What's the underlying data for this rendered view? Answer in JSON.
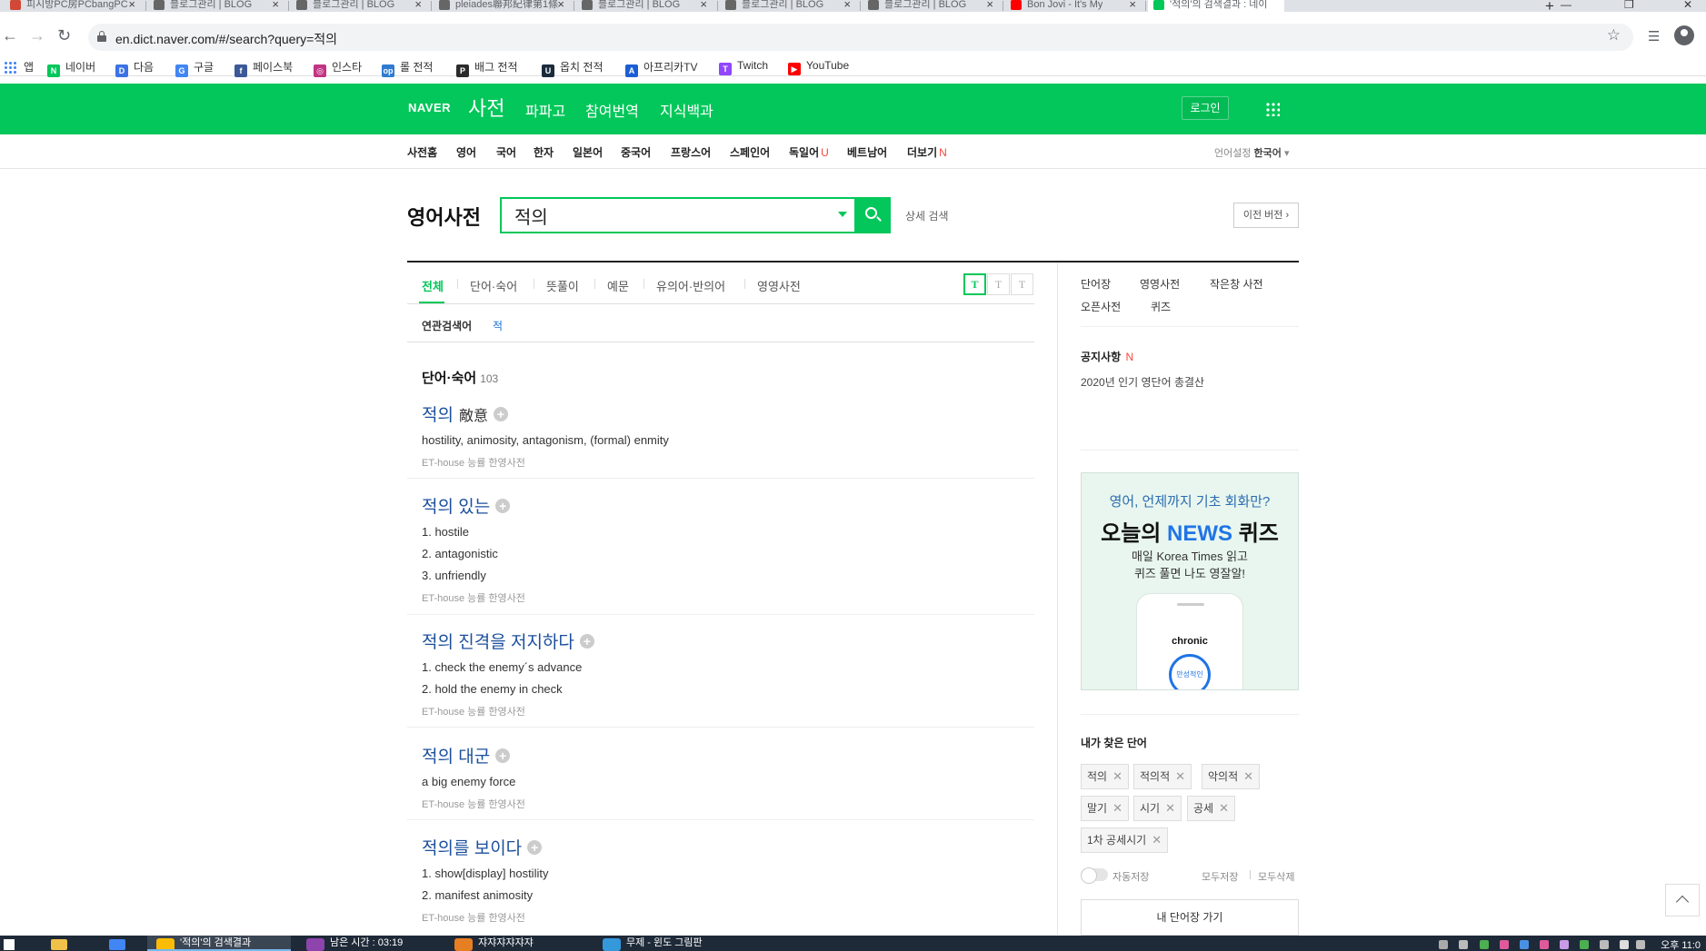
{
  "browser": {
    "tabs": [
      {
        "label": "피시방PC房PCbangPC",
        "active": false,
        "favicon_color": "#d14836"
      },
      {
        "label": "블로그관리 | BLOG",
        "active": false,
        "favicon_color": "#666666"
      },
      {
        "label": "블로그관리 | BLOG",
        "active": false,
        "favicon_color": "#666666"
      },
      {
        "label": "pleiades聯邦紀律第1條",
        "active": false,
        "favicon_color": "#666666"
      },
      {
        "label": "블로그관리 | BLOG",
        "active": false,
        "favicon_color": "#666666"
      },
      {
        "label": "블로그관리 | BLOG",
        "active": false,
        "favicon_color": "#666666"
      },
      {
        "label": "블로그관리 | BLOG",
        "active": false,
        "favicon_color": "#666666"
      },
      {
        "label": "Bon Jovi - It's My",
        "active": false,
        "favicon_color": "#ff0000"
      },
      {
        "label": "'적의'의 검색결과 : 네이",
        "active": true,
        "favicon_color": "#03c75a"
      }
    ],
    "new_tab_symbol": "+",
    "url": "en.dict.naver.com/#/search?query=적의",
    "bookmarks": [
      {
        "label": "앱",
        "icon": "apps-grid-icon",
        "color": "#4285f4"
      },
      {
        "label": "네이버",
        "icon": "naver-icon",
        "color": "#03c75a",
        "glyph": "N"
      },
      {
        "label": "다음",
        "icon": "daum-icon",
        "color": "#3b73e6",
        "glyph": "D"
      },
      {
        "label": "구글",
        "icon": "google-icon",
        "color": "#4285f4",
        "glyph": "G"
      },
      {
        "label": "페이스북",
        "icon": "facebook-icon",
        "color": "#3b5998",
        "glyph": "f"
      },
      {
        "label": "인스타",
        "icon": "instagram-icon",
        "color": "#c13584",
        "glyph": "◎"
      },
      {
        "label": "롤 전적",
        "icon": "opgg-icon",
        "color": "#2f7bd1",
        "glyph": "op"
      },
      {
        "label": "배그 전적",
        "icon": "pubg-icon",
        "color": "#2b2b2b",
        "glyph": "P"
      },
      {
        "label": "옵치 전적",
        "icon": "overwatch-icon",
        "color": "#1b2b3c",
        "glyph": "U"
      },
      {
        "label": "아프리카TV",
        "icon": "afreeca-icon",
        "color": "#1c5fd4",
        "glyph": "A"
      },
      {
        "label": "Twitch",
        "icon": "twitch-icon",
        "color": "#9146ff",
        "glyph": "T"
      },
      {
        "label": "YouTube",
        "icon": "youtube-icon",
        "color": "#ff0000",
        "glyph": "▶"
      }
    ]
  },
  "naver": {
    "logo": "NAVER",
    "dict_title": "사전",
    "top_links": [
      "파파고",
      "참여번역",
      "지식백과"
    ],
    "login_label": "로그인",
    "subnav": [
      {
        "label": "사전홈",
        "badge": ""
      },
      {
        "label": "영어",
        "badge": ""
      },
      {
        "label": "국어",
        "badge": ""
      },
      {
        "label": "한자",
        "badge": ""
      },
      {
        "label": "일본어",
        "badge": ""
      },
      {
        "label": "중국어",
        "badge": ""
      },
      {
        "label": "프랑스어",
        "badge": ""
      },
      {
        "label": "스페인어",
        "badge": ""
      },
      {
        "label": "독일어",
        "badge": "U"
      },
      {
        "label": "베트남어",
        "badge": ""
      },
      {
        "label": "더보기",
        "badge": "N"
      }
    ],
    "lang_setting_label": "언어설정",
    "lang_setting_value": "한국어"
  },
  "search": {
    "section_title": "영어사전",
    "query": "적의",
    "advanced_label": "상세 검색",
    "prev_version_label": "이전 버전"
  },
  "result_tabs": [
    {
      "label": "전체",
      "active": true
    },
    {
      "label": "단어·숙어",
      "active": false
    },
    {
      "label": "뜻풀이",
      "active": false
    },
    {
      "label": "예문",
      "active": false
    },
    {
      "label": "유의어·반의어",
      "active": false
    },
    {
      "label": "영영사전",
      "active": false
    }
  ],
  "font_sizes": [
    {
      "label": "T",
      "selected": true
    },
    {
      "label": "T",
      "selected": false
    },
    {
      "label": "T",
      "selected": false
    }
  ],
  "related": {
    "label": "연관검색어",
    "term": "적"
  },
  "words": {
    "title": "단어·숙어",
    "count": "103",
    "entries": [
      {
        "head": "적의",
        "hanja": "敵意",
        "meanings": [
          "hostility, animosity, antagonism, (formal) enmity"
        ],
        "source": "ET-house 능률 한영사전"
      },
      {
        "head": "적의 있는",
        "hanja": "",
        "meanings": [
          "1. hostile",
          "2. antagonistic",
          "3. unfriendly"
        ],
        "source": "ET-house 능률 한영사전"
      },
      {
        "head": "적의 진격을 저지하다",
        "hanja": "",
        "meanings": [
          "1. check the enemy´s advance",
          "2. hold the enemy in check"
        ],
        "source": "ET-house 능률 한영사전"
      },
      {
        "head": "적의 대군",
        "hanja": "",
        "meanings": [
          "a big enemy force"
        ],
        "source": "ET-house 능률 한영사전"
      },
      {
        "head": "적의를 보이다",
        "hanja": "",
        "meanings": [
          "1. show[display] hostility",
          "2. manifest animosity"
        ],
        "source": "ET-house 능률 한영사전"
      }
    ]
  },
  "sidebar": {
    "links_row1": [
      "단어장",
      "영영사전",
      "작은창 사전"
    ],
    "links_row2": [
      "오픈사전",
      "퀴즈"
    ],
    "notice_title": "공지사항",
    "notice_badge": "N",
    "notice_text": "2020년 인기 영단어 총결산",
    "banner": {
      "line1": "영어, 언제까지 기초 회화만?",
      "line2_prefix": "오늘의 ",
      "line2_accent": "NEWS",
      "line2_suffix": " 퀴즈",
      "line3a": "매일 Korea Times 읽고",
      "line3b": "퀴즈 풀면 나도 영잘알!",
      "phone_word": "chronic",
      "phone_button": "만성적인"
    },
    "recent_title": "내가 찾은 단어",
    "recent_words": [
      "적의",
      "적의적",
      "악의적",
      "말기",
      "시기",
      "공세",
      "1차 공세시기"
    ],
    "auto_save_label": "자동저장",
    "save_all_label": "모두저장",
    "delete_all_label": "모두삭제",
    "wordbook_button": "내 단어장 가기"
  },
  "taskbar": {
    "items": [
      {
        "label": "'적의'의 검색결과",
        "active": true,
        "color": "#fbbc05"
      },
      {
        "label": "남은 시간 : 03:19",
        "active": false,
        "color": "#8e44ad"
      },
      {
        "label": "쟈쟈쟈쟈쟈쟈",
        "active": false,
        "color": "#e67e22"
      },
      {
        "label": "무제 - 윈도 그림판",
        "active": false,
        "color": "#3498db"
      }
    ],
    "time": "오후 11:0"
  }
}
